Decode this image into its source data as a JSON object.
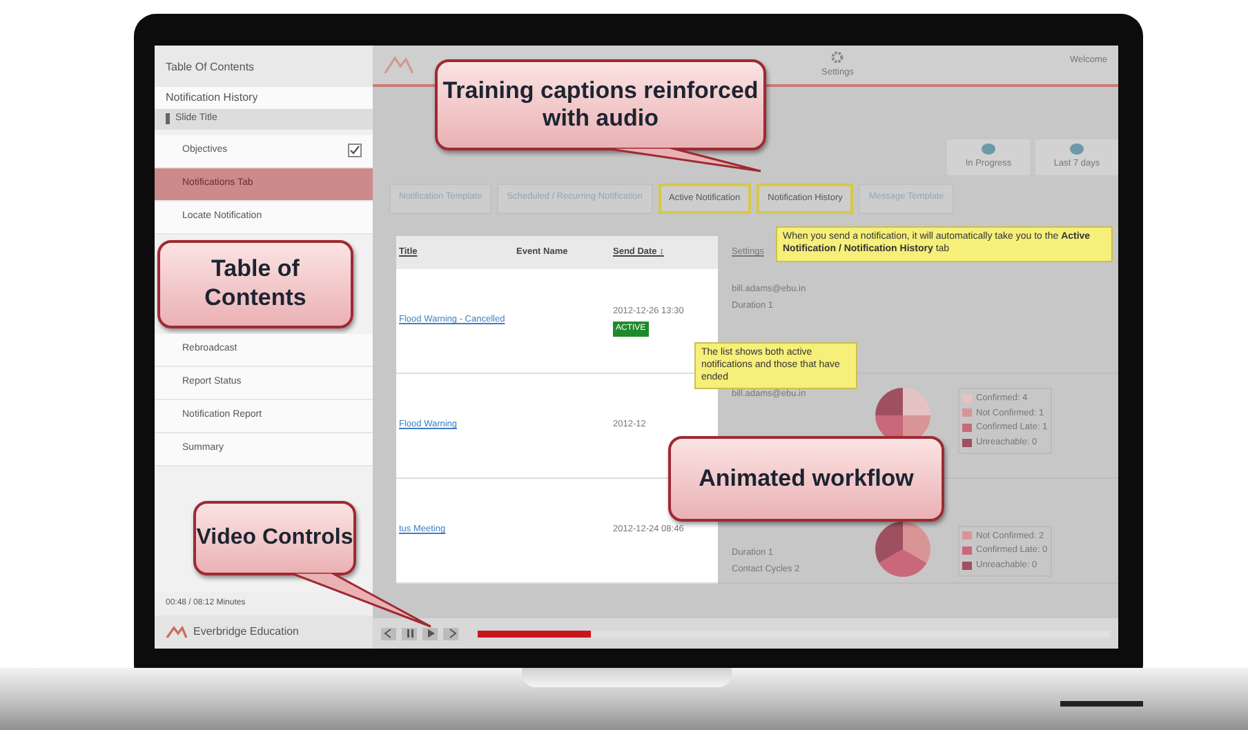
{
  "sidebar": {
    "title": "Table Of Contents",
    "subtitle": "Notification History",
    "section": "Slide Title",
    "items": [
      {
        "label": "Objectives",
        "checked": true,
        "selected": false
      },
      {
        "label": "Notifications Tab",
        "checked": false,
        "selected": true
      },
      {
        "label": "Locate Notification",
        "checked": false,
        "selected": false
      },
      {
        "label": "Rebroadcast",
        "checked": false,
        "selected": false
      },
      {
        "label": "Report Status",
        "checked": false,
        "selected": false
      },
      {
        "label": "Notification Report",
        "checked": false,
        "selected": false
      },
      {
        "label": "Summary",
        "checked": false,
        "selected": false
      }
    ],
    "time": "00:48 / 08:12 Minutes",
    "brand": "Everbridge Education"
  },
  "header": {
    "nav": "Settings",
    "welcome": "Welcome"
  },
  "stats": [
    {
      "label": "In Progress"
    },
    {
      "label": "Last 7 days"
    }
  ],
  "tabs": [
    {
      "label": "Notification Template",
      "highlighted": false
    },
    {
      "label": "Scheduled / Recurring Notification",
      "highlighted": false
    },
    {
      "label": "Active Notification",
      "highlighted": true
    },
    {
      "label": "Notification History",
      "highlighted": true
    },
    {
      "label": "Message Template",
      "highlighted": false
    }
  ],
  "table": {
    "columns": [
      "Title",
      "Event Name",
      "Send Date ↕",
      "Settings"
    ],
    "rows": [
      {
        "title": "Flood Warning - Cancelled",
        "send_date": "2012-12-26 13:30",
        "status": "ACTIVE",
        "settings": [
          "bill.adams@ebu.in",
          "Duration 1"
        ],
        "legend": []
      },
      {
        "title": "Flood Warning",
        "send_date": "2012-12",
        "settings": [
          "bill.adams@ebu.in"
        ],
        "legend": [
          {
            "label": "Confirmed: 4",
            "color": "#e6c3c3"
          },
          {
            "label": "Not Confirmed: 1",
            "color": "#d99595"
          },
          {
            "label": "Confirmed Late: 1",
            "color": "#c9687a"
          },
          {
            "label": "Unreachable: 0",
            "color": "#9e5061"
          }
        ]
      },
      {
        "title": "tus Meeting",
        "send_date": "2012-12-24 08:46",
        "settings": [
          "Duration 1",
          "Contact Cycles 2"
        ],
        "legend": [
          {
            "label": "Not Confirmed: 2",
            "color": "#d99595"
          },
          {
            "label": "Confirmed Late: 0",
            "color": "#c9687a"
          },
          {
            "label": "Unreachable: 0",
            "color": "#9e5061"
          }
        ]
      }
    ]
  },
  "tooltips": [
    "When you send a notification, it will automatically take you to the **Active Notification / Notification History** tab",
    "The list shows both active notifications and those that have ended"
  ],
  "callouts": [
    "Training captions reinforced with audio",
    "Table of Contents",
    "Animated workflow",
    "Video Controls"
  ],
  "player": {
    "level": 0.18
  }
}
